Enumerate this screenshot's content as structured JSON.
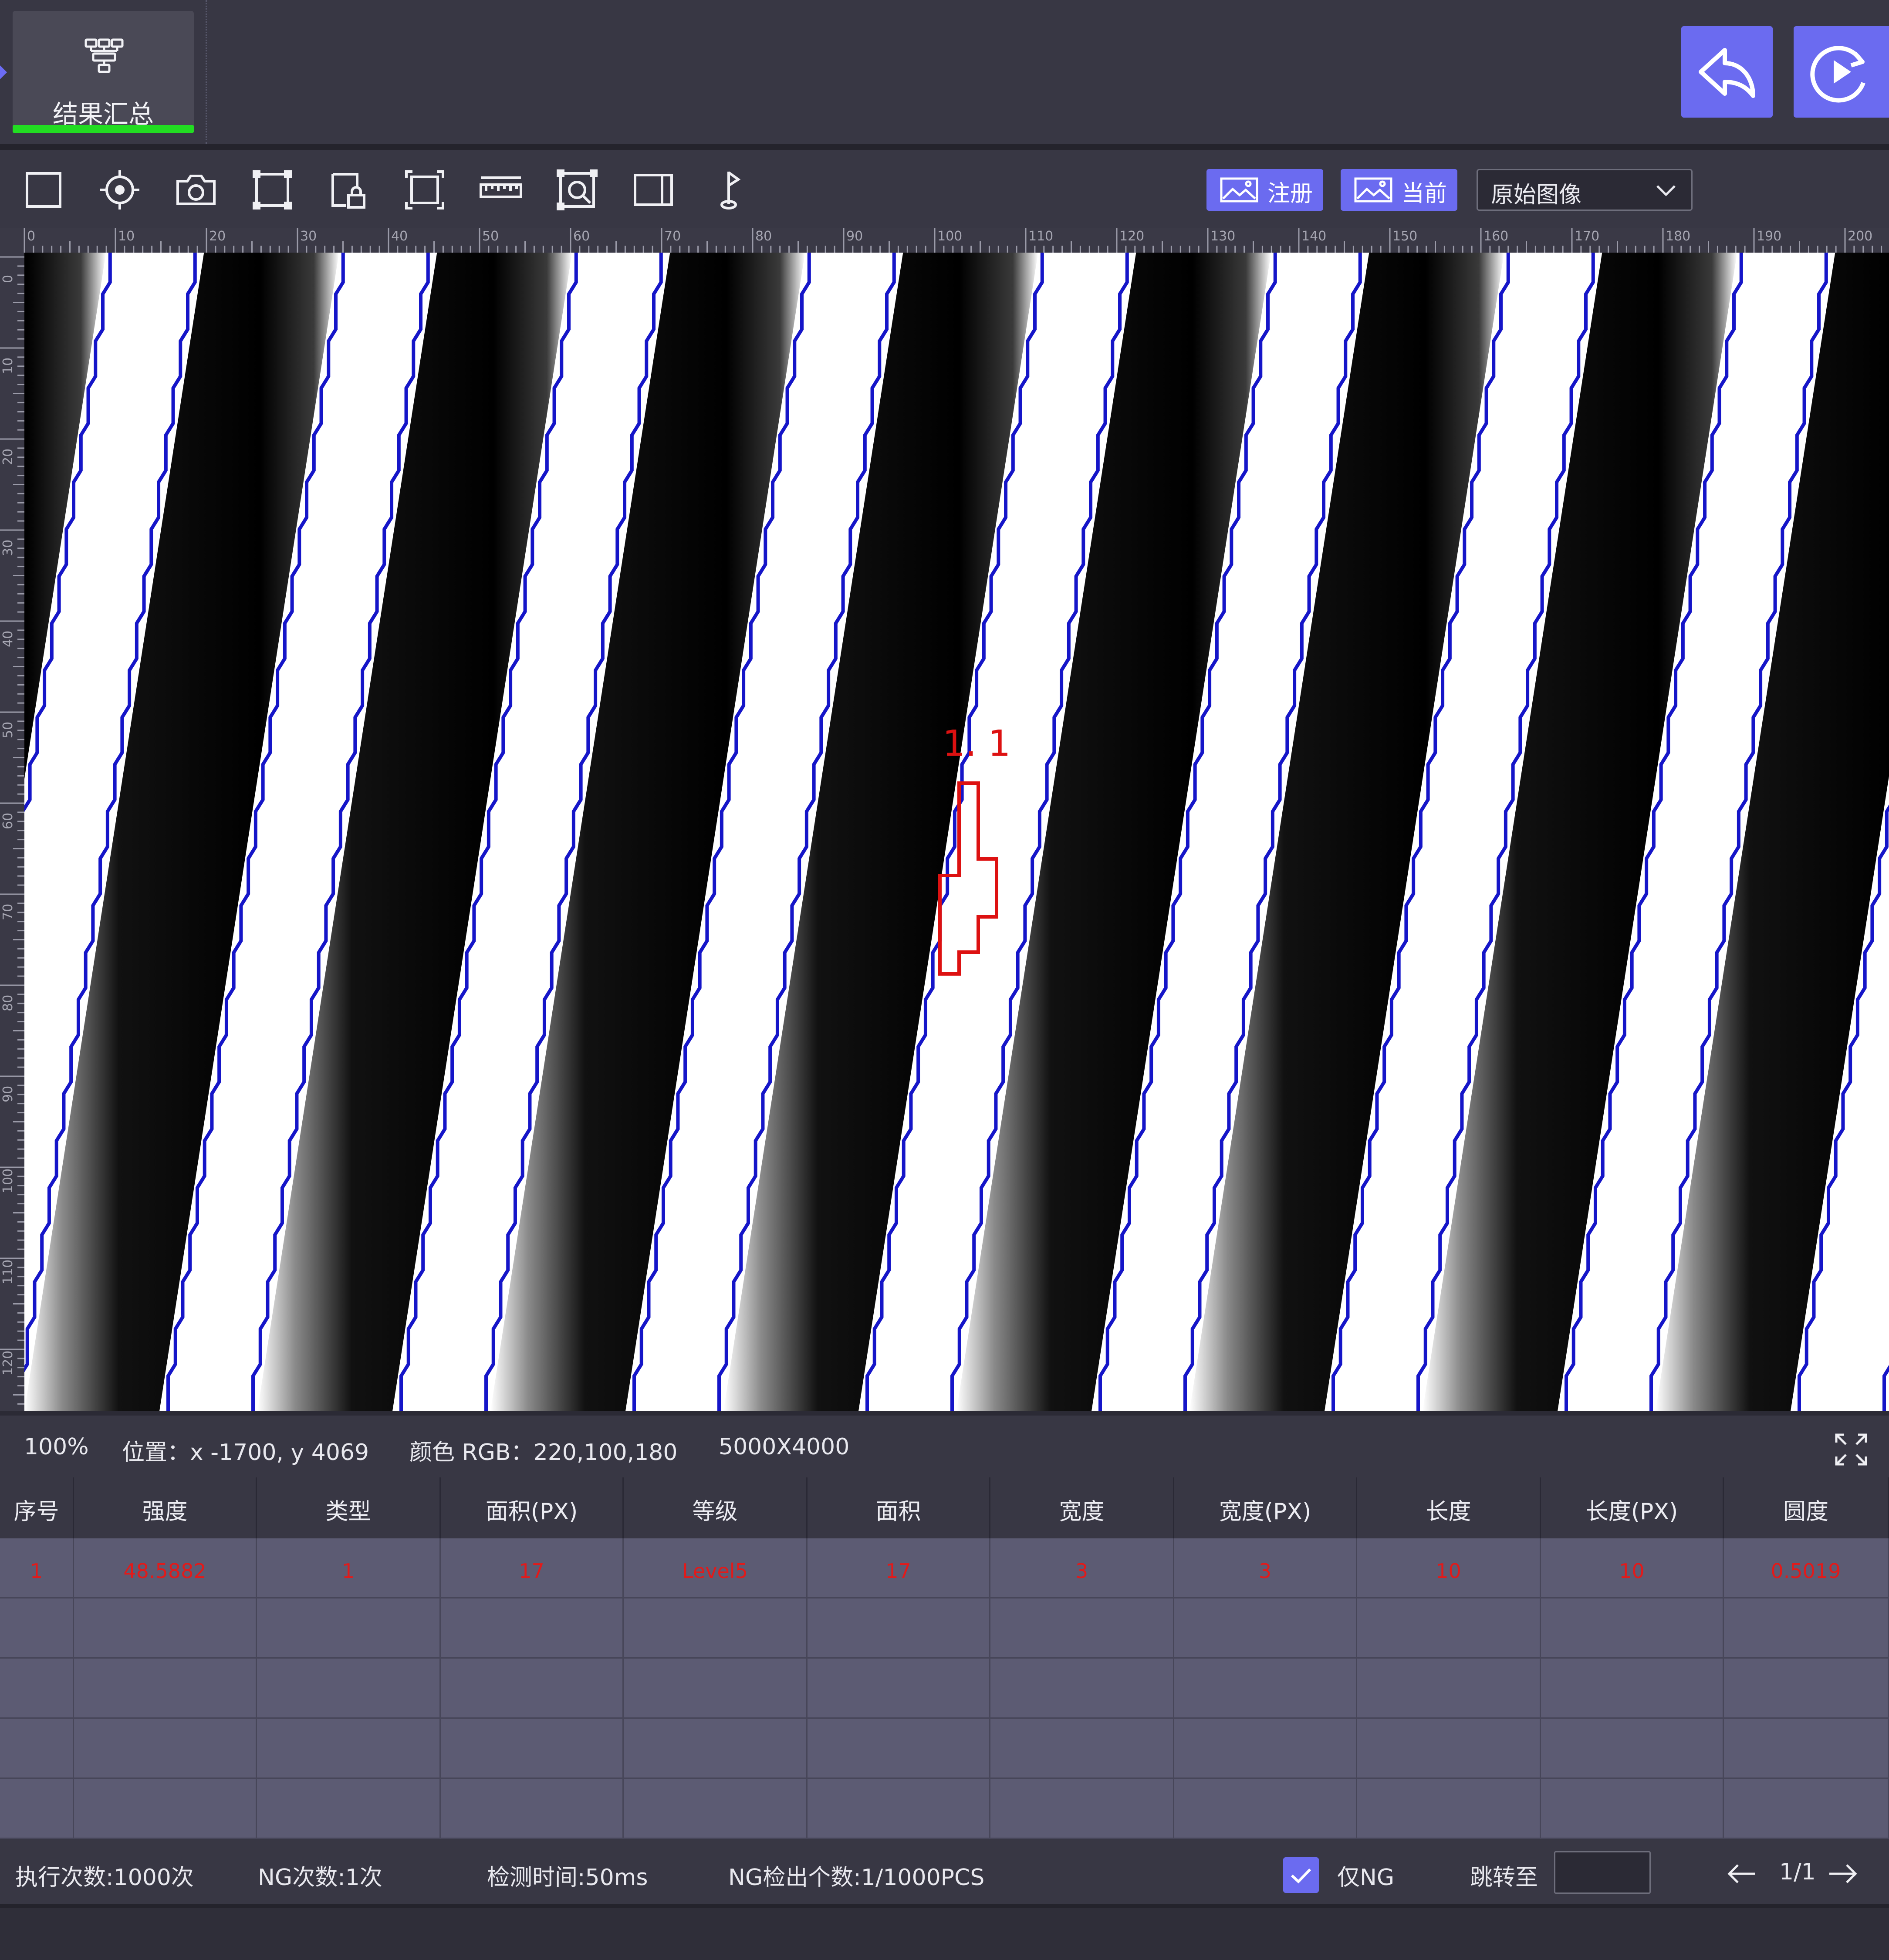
{
  "header": {
    "summary_tab_label": "结果汇总",
    "back_icon": "undo-arrow-icon",
    "run_icon": "play-loop-icon"
  },
  "toolbar": {
    "tools": [
      "rectangle-icon",
      "crosshair-icon",
      "camera-icon",
      "roi-corners-icon",
      "lock-region-icon",
      "fit-frame-icon",
      "ruler-icon",
      "zoom-region-icon",
      "split-panel-icon",
      "pin-marker-icon"
    ],
    "register_label": "注册",
    "current_label": "当前",
    "image_mode_value": "原始图像"
  },
  "ruler": {
    "h_ticks": [
      "0",
      "10",
      "20",
      "30",
      "40",
      "50",
      "60",
      "70",
      "80",
      "90",
      "100",
      "110",
      "120",
      "130",
      "140",
      "150",
      "160",
      "170",
      "180",
      "190",
      "200"
    ],
    "v_ticks": [
      "0",
      "10",
      "20",
      "30",
      "40",
      "50",
      "60",
      "70",
      "80",
      "90",
      "100",
      "110",
      "120"
    ]
  },
  "canvas": {
    "defect_label": "1. 1",
    "accent_edge": "#1515c8",
    "defect_color": "#dd1111"
  },
  "status": {
    "zoom": "100%",
    "position": "位置：x -1700, y 4069",
    "color": "颜色  RGB：220,100,180",
    "resolution": "5000X4000"
  },
  "table": {
    "headers": [
      "序号",
      "强度",
      "类型",
      "面积(PX)",
      "等级",
      "面积",
      "宽度",
      "宽度(PX)",
      "长度",
      "长度(PX)",
      "圆度"
    ],
    "rows": [
      [
        "1",
        "48.5882",
        "1",
        "17",
        "Level5",
        "17",
        "3",
        "3",
        "10",
        "10",
        "0.5019"
      ]
    ]
  },
  "footer": {
    "exec_count": "执行次数:1000次",
    "ng_count": "NG次数:1次",
    "detect_time": "检测时间:50ms",
    "ng_detect": "NG检出个数:1/1000PCS",
    "only_ng_label": "仅NG",
    "only_ng_checked": true,
    "jump_label": "跳转至",
    "jump_value": "",
    "page": "1/1"
  }
}
